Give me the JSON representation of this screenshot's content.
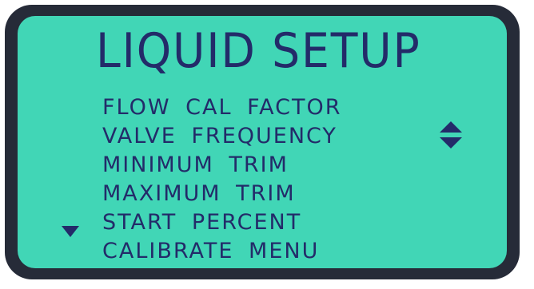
{
  "screen": {
    "title": "LIQUID SETUP",
    "menu_items": [
      "FLOW CAL FACTOR",
      "VALVE FREQUENCY",
      "MINIMUM TRIM",
      "MAXIMUM TRIM",
      "START PERCENT",
      "CALIBRATE MENU"
    ],
    "icons": {
      "scroll": "up-down-arrows-icon",
      "more_below": "down-triangle-icon"
    }
  },
  "colors": {
    "frame": "#262b38",
    "screen_background": "#41d6b6",
    "text": "#232b69"
  }
}
